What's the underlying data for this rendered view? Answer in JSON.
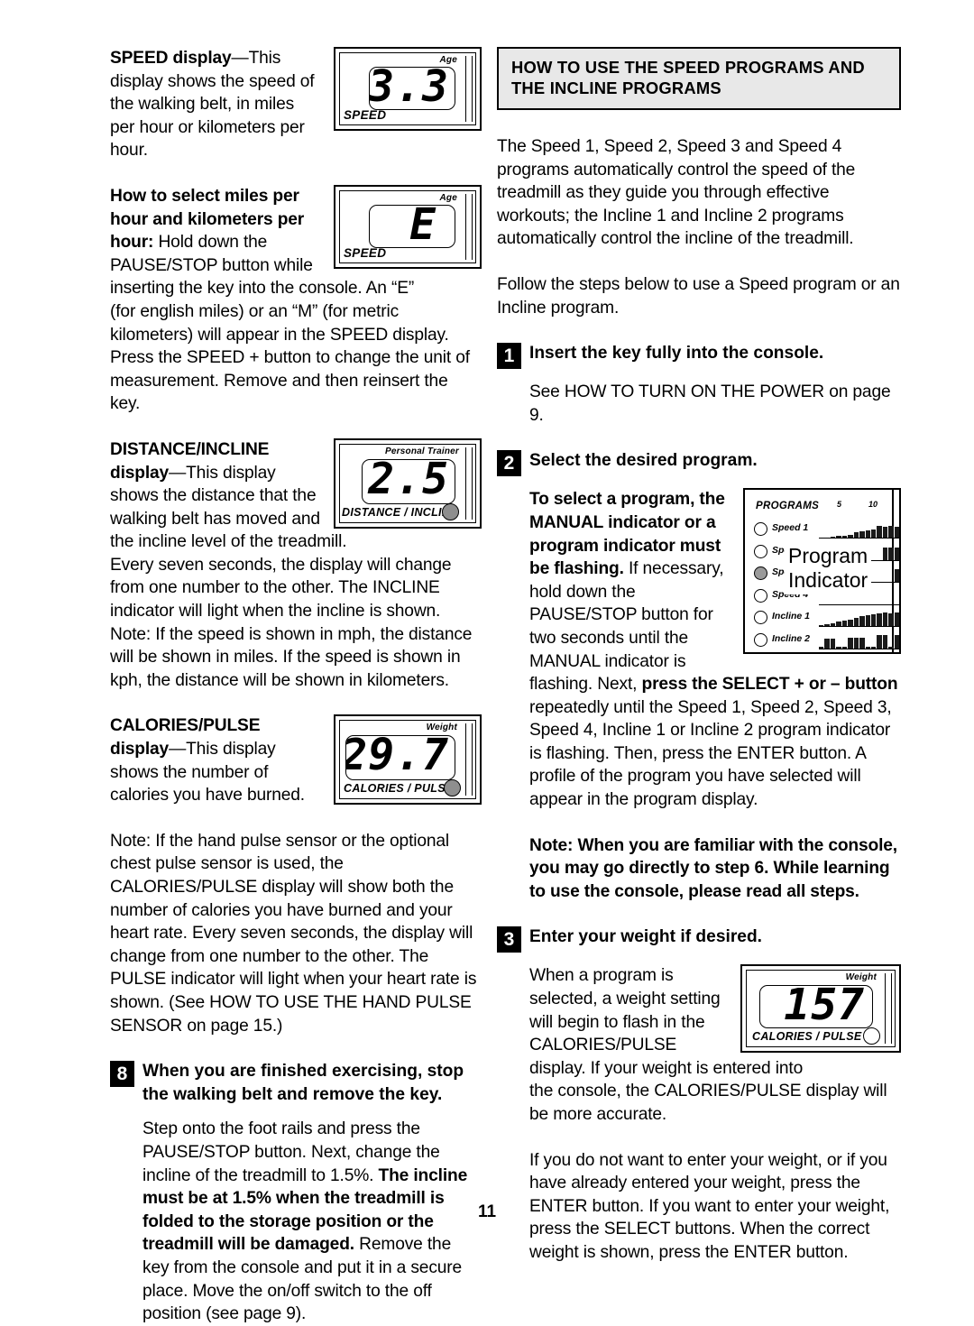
{
  "page": {
    "number": "11"
  },
  "left_column": {
    "speed_section": {
      "title_bold": "SPEED display",
      "body": "—This display shows the speed of the walking belt, in miles per hour or kilometers per hour.",
      "figure": {
        "caption_top": "Age",
        "digits": "3.3",
        "label": "SPEED"
      }
    },
    "units_section": {
      "title_bold": "How to select miles per hour and kilometers per hour:",
      "body_wrap": " Hold down the PAUSE/STOP button while inserting the key into the console. An “E”",
      "body_full": "(for english miles) or an “M” (for metric kilometers) will appear in the SPEED display. Press the SPEED + button to change the unit of measurement. Remove and then reinsert the key.",
      "figure": {
        "caption_top": "Age",
        "digits": "E",
        "label": "SPEED"
      }
    },
    "distance_section": {
      "title_bold": "DISTANCE/INCLINE display",
      "body_wrap": "—This display shows the distance that the walking belt has moved and the incline level of the treadmill.",
      "body_full": "Every seven seconds, the display will change from one number to the other. The INCLINE indicator will light when the incline is shown. Note: If the speed is shown in mph, the distance will be shown in miles. If the speed is shown in kph, the distance will be shown in kilometers.",
      "figure": {
        "caption_top": "Personal Trainer",
        "digits": "2.5",
        "label": "DISTANCE / INCLINE"
      }
    },
    "calories_section": {
      "title_bold": "CALORIES/PULSE display",
      "body_wrap": "—This display shows the number of calories you have burned.",
      "note": "Note: If the hand pulse sensor or the optional chest pulse sensor is used, the CALORIES/PULSE display will show both the number of calories you have burned and your heart rate. Every seven seconds, the display will change from one number to the other. The PULSE indicator will light when your heart rate is shown. (See HOW TO USE THE HAND PULSE SENSOR on page 15.)",
      "figure": {
        "caption_top": "Weight",
        "digits": "29.7",
        "label": "CALORIES / PULSE"
      }
    },
    "step8": {
      "number": "8",
      "title": "When you are finished exercising, stop the walking belt and remove the key.",
      "body_part1": "Step onto the foot rails and press the PAUSE/STOP button. Next, change the incline of the treadmill to 1.5%. ",
      "body_bold": "The incline must be at 1.5% when the treadmill is folded to the storage position or the treadmill will be damaged.",
      "body_part2": " Remove the key from the console and put it in a secure place. Move the on/off switch to the off position (see page 9)."
    }
  },
  "right_column": {
    "section_header": "HOW TO USE THE SPEED PROGRAMS AND THE INCLINE PROGRAMS",
    "intro_para1": "The Speed 1, Speed 2, Speed 3 and Speed 4 programs automatically control the speed of the treadmill as they guide you through effective workouts; the Incline 1 and Incline 2 programs automatically control the incline of the treadmill.",
    "intro_para2": "Follow the steps below to use a Speed program or an Incline program.",
    "step1": {
      "number": "1",
      "title": "Insert the key fully into the console.",
      "body": "See HOW TO TURN ON THE POWER on page 9."
    },
    "step2": {
      "number": "2",
      "title": "Select the desired program.",
      "body_bold1": "To select a program, the MANUAL indicator or a program indicator must be flashing.",
      "body_plain1": " If necessary, hold down the PAUSE/STOP button for two seconds until the MANUAL indicator is flashing. Next, ",
      "body_bold2": "press the SELECT + or – button",
      "body_plain2": " repeatedly until the Speed 1, Speed 2, Speed 3, Speed 4, Incline 1 or Incline 2 program indicator is flashing. Then, press the ENTER button. A profile of the program you have selected will appear in the program display.",
      "note_bold": "Note: When you are familiar with the console, you may go directly to step 6. While learning to use the console, please read all steps."
    },
    "step3": {
      "number": "3",
      "title": "Enter your weight if desired.",
      "body_wrap": "When a program is selected, a weight setting will begin to flash in the CALORIES/PULSE display. If your weight is entered into",
      "body_full": "the console, the CALORIES/PULSE display will be more accurate.",
      "body_para2": "If you do not want to enter your weight, or if you have already entered your weight, press the ENTER button. If you want to enter your weight, press the SELECT buttons. When the correct weight is shown, press the ENTER button.",
      "figure": {
        "caption_top": "Weight",
        "digits": "157",
        "label": "CALORIES / PULSE"
      }
    },
    "program_panel": {
      "title": "PROGRAMS",
      "scale_marks": [
        "5",
        "10"
      ],
      "overlay_line1": "Program",
      "overlay_line2": "Indicator",
      "programs": [
        {
          "name": "Speed 1",
          "selected": false
        },
        {
          "name": "Speed 2",
          "selected": false
        },
        {
          "name": "Speed 3",
          "selected": true
        },
        {
          "name": "Speed 4",
          "selected": false
        },
        {
          "name": "Incline 1",
          "selected": false
        },
        {
          "name": "Incline 2",
          "selected": false
        }
      ],
      "profiles": {
        "Speed 1": [
          1,
          1,
          2,
          3,
          3,
          4,
          6,
          7,
          8,
          9,
          12,
          11,
          12,
          11,
          12,
          12
        ],
        "Speed 2": [
          1,
          1,
          1,
          1,
          1,
          1,
          1,
          1,
          1,
          1,
          1,
          12,
          12,
          12,
          12,
          12
        ],
        "Speed 3": [
          1,
          1,
          1,
          1,
          1,
          1,
          1,
          1,
          1,
          1,
          1,
          1,
          1,
          13,
          13,
          13
        ],
        "Speed 4": [
          1,
          1,
          1,
          1,
          1,
          1,
          1,
          1,
          1,
          1,
          1,
          1,
          1,
          1,
          1,
          13
        ],
        "Incline 1": [
          2,
          3,
          4,
          5,
          6,
          7,
          9,
          10,
          11,
          12,
          13,
          14,
          13,
          14,
          13,
          14
        ],
        "Incline 2": [
          2,
          10,
          10,
          2,
          2,
          11,
          11,
          11,
          2,
          2,
          13,
          13,
          2,
          13,
          13,
          2
        ]
      }
    }
  }
}
